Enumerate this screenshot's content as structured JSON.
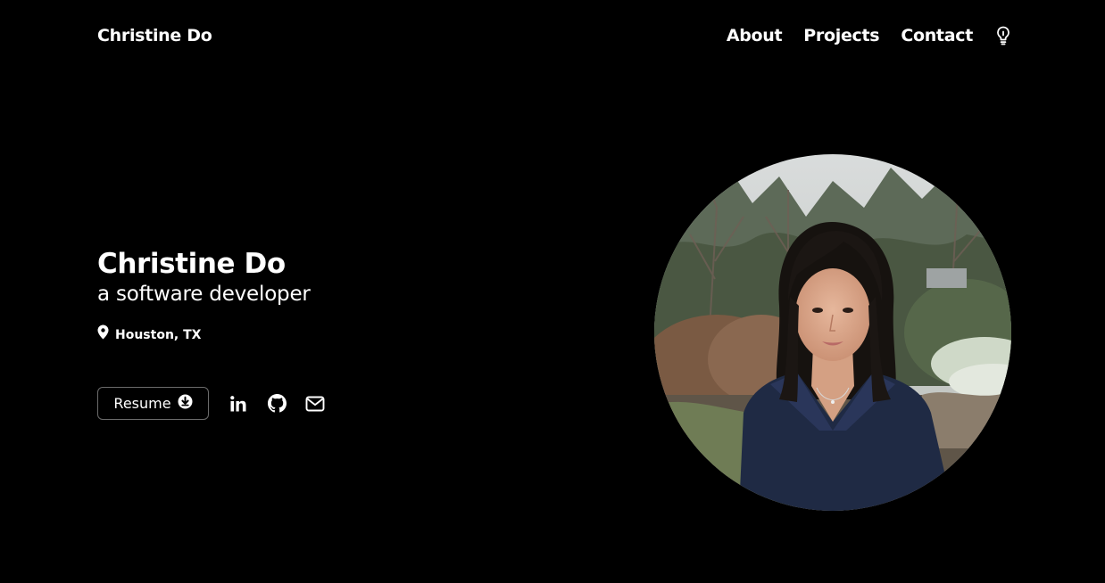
{
  "header": {
    "brand": "Christine Do",
    "nav": [
      {
        "label": "About"
      },
      {
        "label": "Projects"
      },
      {
        "label": "Contact"
      }
    ],
    "theme_toggle_icon": "lightbulb-icon"
  },
  "hero": {
    "name": "Christine Do",
    "role": "a software developer",
    "location": "Houston, TX",
    "location_icon": "map-pin-icon",
    "resume_label": "Resume",
    "resume_icon": "download-circle-icon",
    "social_icons": [
      "linkedin-icon",
      "github-icon",
      "mail-icon"
    ]
  },
  "portrait": {
    "description_icon": "profile-photo"
  },
  "colors": {
    "background": "#000000",
    "text": "#ffffff",
    "button_border": "#6b6b6b"
  }
}
